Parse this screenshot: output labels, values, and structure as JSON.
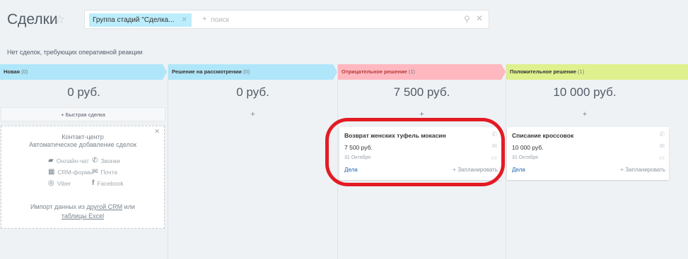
{
  "header": {
    "title": "Сделки",
    "filter_tag": "Группа стадий \"Сделка...",
    "filter_plus": "+",
    "search_placeholder": "поиск"
  },
  "notice": "Нет сделок, требующих оперативной реакции",
  "colors": {
    "stage_new": "#b0e6f9",
    "stage_review": "#b0e6f9",
    "stage_negative": "#ffb8c0",
    "stage_positive": "#dff08e",
    "accent_link": "#2067b0",
    "highlight": "#e31b24"
  },
  "columns": [
    {
      "name": "Новая",
      "count": "(0)",
      "sum": "0 руб.",
      "add": "+ Быстрая сделка"
    },
    {
      "name": "Решение на рассмотрении",
      "count": "(0)",
      "sum": "0 руб.",
      "add": "+"
    },
    {
      "name": "Отрицательное решение",
      "count": "(1)",
      "sum": "7 500 руб.",
      "add": "+"
    },
    {
      "name": "Положительное решение",
      "count": "(1)",
      "sum": "10 000 руб.",
      "add": "+"
    }
  ],
  "widget": {
    "title": "Контакт-центр",
    "subtitle": "Автоматическое добавление сделок",
    "items": {
      "chat": "Онлайн-чат",
      "calls": "Звонки",
      "crm_forms": "CRM-формы",
      "mail": "Почта",
      "viber": "Viber",
      "facebook": "Facebook"
    },
    "import_prefix": "Импорт данных из",
    "import_link1": "другой CRM",
    "import_mid": "или",
    "import_link2": "таблицы Excel"
  },
  "cards": [
    {
      "title": "Возврат женских туфель мокасин",
      "sum": "7 500 руб.",
      "date": "31 Октября",
      "link": "Дела",
      "plan": "+ Запланировать"
    },
    {
      "title": "Списание кроссовок",
      "sum": "10 000 руб.",
      "date": "31 Октября",
      "link": "Дела",
      "plan": "+ Запланировать"
    }
  ]
}
